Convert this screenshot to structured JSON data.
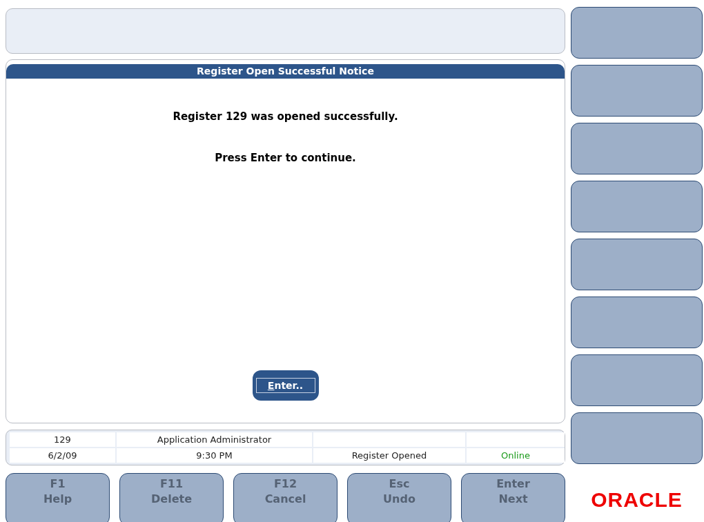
{
  "dialog": {
    "title": "Register Open Successful Notice",
    "messages": [
      "Register 129 was opened successfully.",
      "Press Enter to continue."
    ],
    "button": {
      "label": "Enter..",
      "disabled": false
    }
  },
  "status_bar": {
    "rows": [
      [
        "129",
        "Application Administrator",
        "",
        ""
      ],
      [
        "6/2/09",
        "9:30 PM",
        "Register Opened",
        "Online"
      ]
    ],
    "online": true
  },
  "side_buttons": [
    {
      "disabled": true
    },
    {
      "disabled": true
    },
    {
      "disabled": true
    },
    {
      "disabled": true
    },
    {
      "disabled": true
    },
    {
      "disabled": true
    },
    {
      "disabled": true
    },
    {
      "disabled": true
    }
  ],
  "function_keys": [
    {
      "key": "F1",
      "label": "Help",
      "disabled": true
    },
    {
      "key": "F11",
      "label": "Delete",
      "disabled": true
    },
    {
      "key": "F12",
      "label": "Cancel",
      "disabled": true
    },
    {
      "key": "Esc",
      "label": "Undo",
      "disabled": true
    },
    {
      "key": "Enter",
      "label": "Next",
      "disabled": true
    }
  ],
  "logo": {
    "text": "ORACLE"
  }
}
